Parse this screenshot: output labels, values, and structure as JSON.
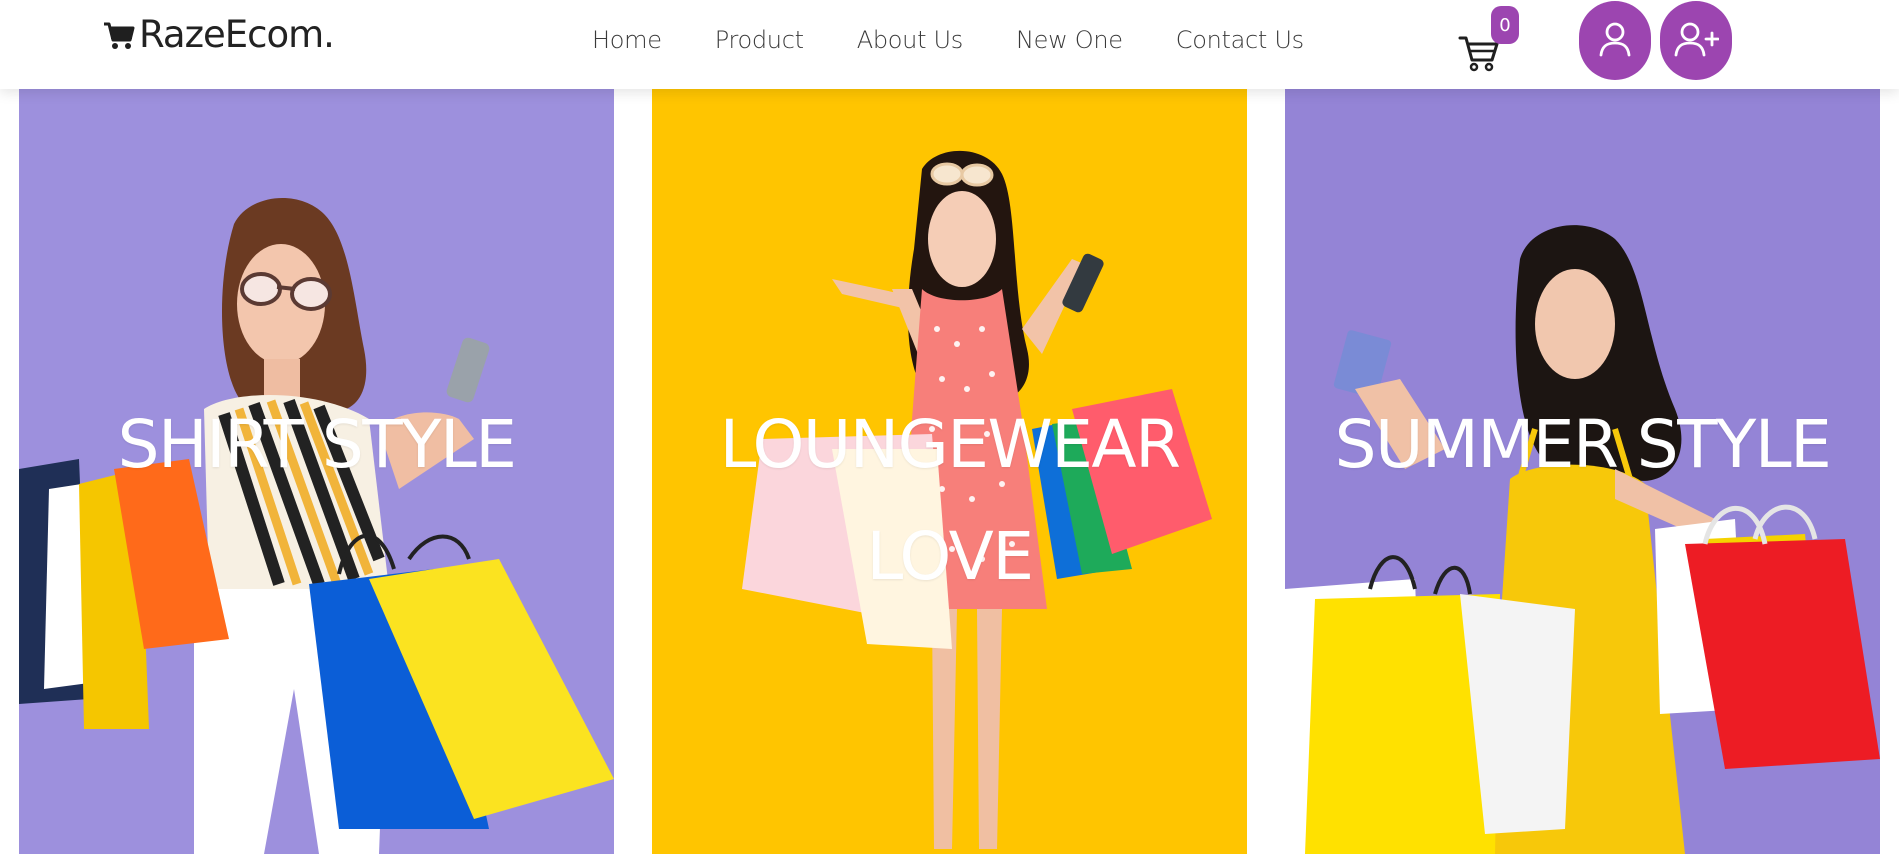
{
  "header": {
    "brand": "RazeEcom.",
    "nav": [
      "Home",
      "Product",
      "About Us",
      "New One",
      "Contact Us"
    ],
    "cart_count": "0"
  },
  "cards": [
    {
      "title": "SHIRT STYLE"
    },
    {
      "title": "LOUNGEWEAR LOVE"
    },
    {
      "title": "SUMMER STYLE"
    }
  ],
  "colors": {
    "accent": "#9c45b0",
    "card_purple": "#9b8fdc",
    "card_yellow": "#ffc400"
  },
  "icons": [
    "shopping-cart-icon",
    "user-icon",
    "user-plus-icon"
  ]
}
